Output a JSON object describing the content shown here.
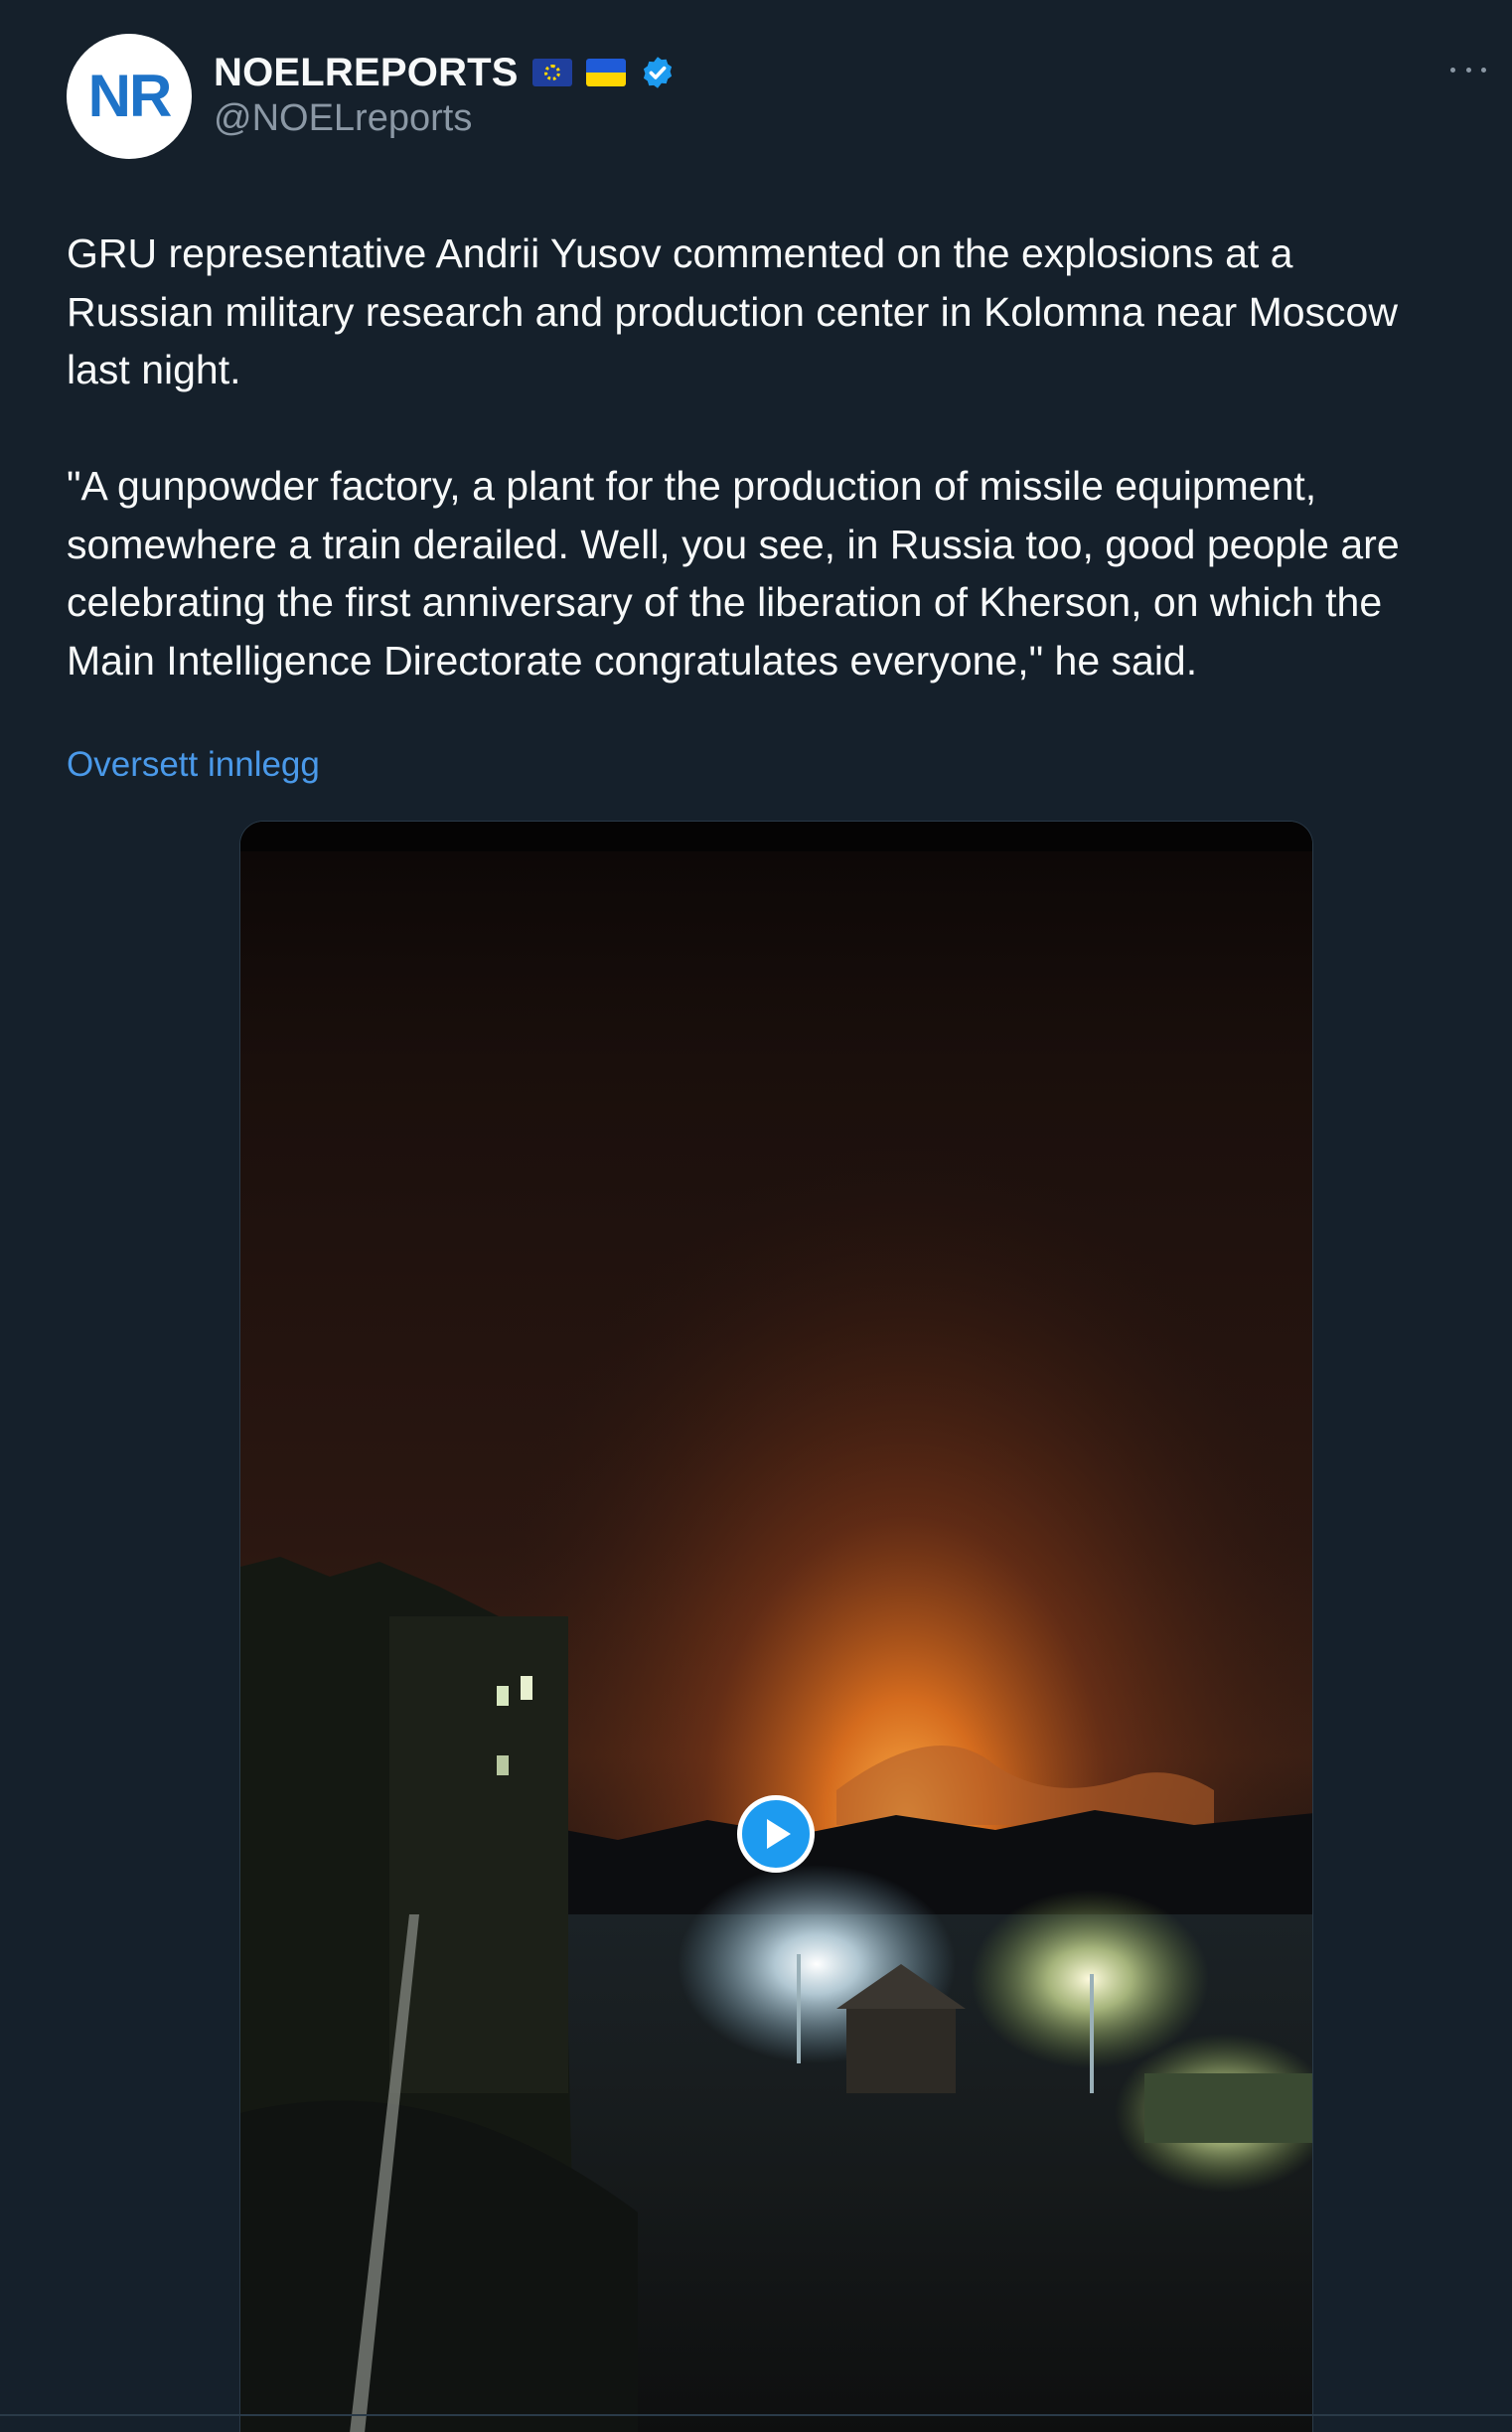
{
  "author": {
    "display_name": "NOELREPORTS",
    "handle": "@NOELreports",
    "avatar_text": "NR",
    "flags": [
      "eu-flag-icon",
      "ukraine-flag-icon"
    ],
    "verified": true
  },
  "tweet": {
    "text": "GRU representative Andrii Yusov commented on the explosions at a\nRussian military research and production center in Kolomna near Moscow\nlast night.\n\n\"A gunpowder factory, a plant for the production of missile equipment,\nsomewhere a train derailed. Well, you see, in Russia too, good people are\ncelebrating the first anniversary of the liberation of Kherson, on which the\nMain Intelligence Directorate congratulates everyone,\" he said.",
    "translate_label": "Oversett innlegg"
  },
  "media": {
    "type": "video",
    "play_icon": "play-icon"
  },
  "colors": {
    "background": "#15202b",
    "text": "#f7f9f9",
    "secondary_text": "#8b98a5",
    "link": "#4a99e9",
    "verified": "#1d9bf0"
  }
}
